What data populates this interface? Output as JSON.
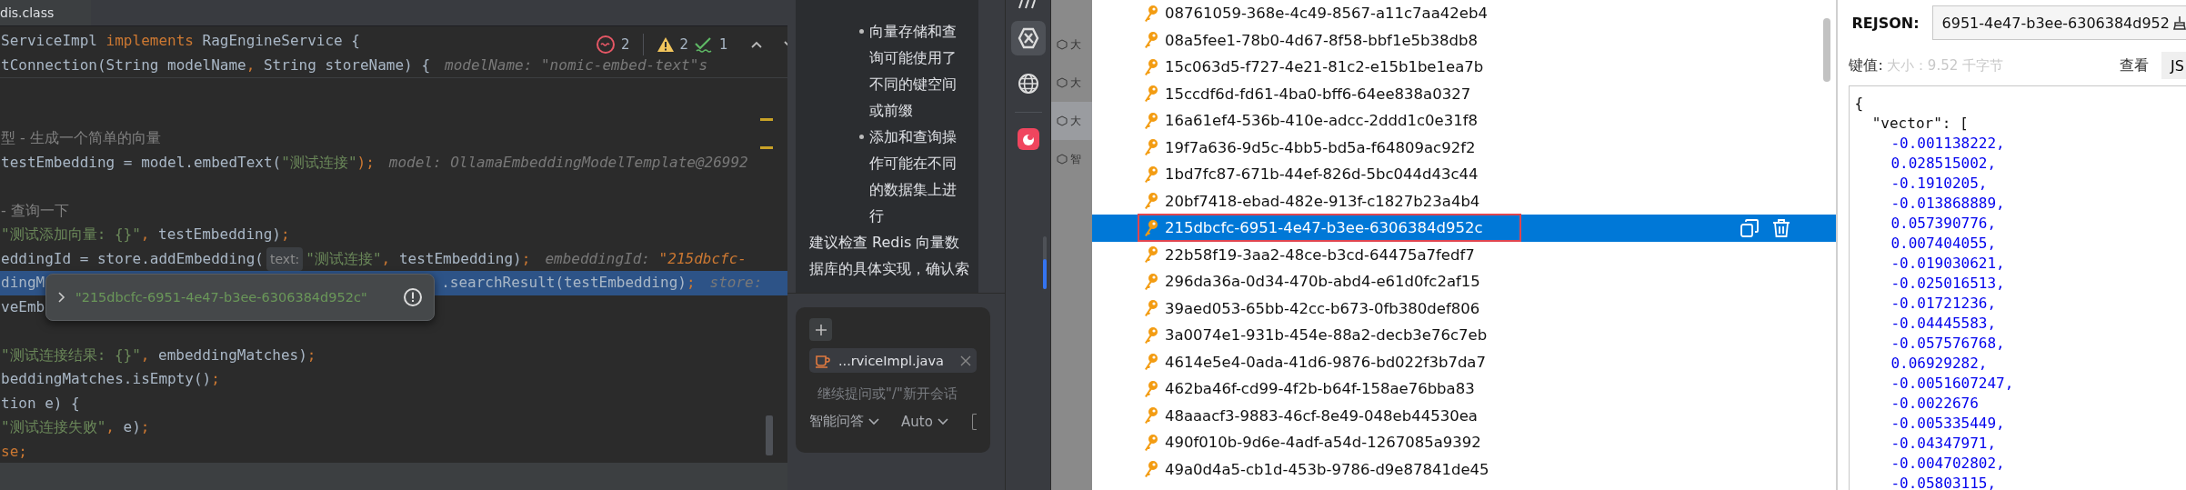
{
  "editor": {
    "tab": "dis.class",
    "inspections": {
      "errors": "2",
      "warnings": "2",
      "checks": "1"
    },
    "lines": [
      {
        "highlighted": false,
        "segments": [
          {
            "t": "ServiceImpl ",
            "kind": "plain"
          },
          {
            "t": "implements ",
            "kind": "keyword"
          },
          {
            "t": "RagEngineService {",
            "kind": "plain"
          }
        ]
      },
      {
        "highlighted": false,
        "segments": [
          {
            "t": "tConnection(String modelName",
            "kind": "plain"
          },
          {
            "t": ", ",
            "kind": "punct"
          },
          {
            "t": "String storeName) {",
            "kind": "plain"
          },
          {
            "t": "modelName: \"nomic-embed-text\"",
            "kind": "hint"
          },
          {
            "t": "s",
            "kind": "hint"
          }
        ]
      },
      {
        "highlighted": false
      },
      {
        "highlighted": false
      },
      {
        "highlighted": false,
        "segments": [
          {
            "t": "型 - 生成一个简单的向量",
            "kind": "comment"
          }
        ]
      },
      {
        "highlighted": false,
        "segments": [
          {
            "t": "testEmbedding = model.embedText(",
            "kind": "plain"
          },
          {
            "t": "\"测试连接\"",
            "kind": "string"
          },
          {
            "t": ");",
            "kind": "punct"
          },
          {
            "t": "model: OllamaEmbeddingModelTemplate@26992",
            "kind": "hint"
          }
        ]
      },
      {
        "highlighted": false
      },
      {
        "highlighted": false,
        "segments": [
          {
            "t": "- 查询一下",
            "kind": "comment"
          }
        ]
      },
      {
        "highlighted": false,
        "segments": [
          {
            "t": "\"测试添加向量: {}\"",
            "kind": "string"
          },
          {
            "t": ", ",
            "kind": "punct"
          },
          {
            "t": "testEmbedding)",
            "kind": "plain"
          },
          {
            "t": ";",
            "kind": "punct"
          }
        ]
      },
      {
        "highlighted": false,
        "segments": [
          {
            "t": "eddingId = store.addEmbedding(",
            "kind": "plain"
          },
          {
            "t": "text:",
            "kind": "inlay"
          },
          {
            "t": "\"测试连接\"",
            "kind": "string"
          },
          {
            "t": ", ",
            "kind": "punct"
          },
          {
            "t": "testEmbedding)",
            "kind": "plain"
          },
          {
            "t": ";",
            "kind": "punct"
          },
          {
            "t": "embeddingId: ",
            "kind": "hint"
          },
          {
            "t": "\"215dbcfc-",
            "kind": "hint_value"
          }
        ]
      },
      {
        "highlighted": true,
        "segments": [
          {
            "t": "dingM",
            "kind": "plain"
          },
          {
            "t": ".searchResult(testEmbedding)",
            "kind": "plain",
            "after_popup": true
          },
          {
            "t": ";",
            "kind": "punct"
          },
          {
            "t": "store:",
            "kind": "hint"
          }
        ]
      },
      {
        "highlighted": false,
        "segments": [
          {
            "t": "veEmb",
            "kind": "plain"
          }
        ]
      },
      {
        "highlighted": false
      },
      {
        "highlighted": false,
        "segments": [
          {
            "t": "\"测试连接结果: {}\"",
            "kind": "string"
          },
          {
            "t": ", ",
            "kind": "punct"
          },
          {
            "t": "embeddingMatches)",
            "kind": "plain"
          },
          {
            "t": ";",
            "kind": "punct"
          }
        ]
      },
      {
        "highlighted": false,
        "segments": [
          {
            "t": "beddingMatches.isEmpty()",
            "kind": "plain"
          },
          {
            "t": ";",
            "kind": "punct"
          }
        ]
      },
      {
        "highlighted": false,
        "segments": [
          {
            "t": "tion e) {",
            "kind": "plain"
          }
        ]
      },
      {
        "highlighted": false,
        "segments": [
          {
            "t": "\"测试连接失败\"",
            "kind": "string"
          },
          {
            "t": ", ",
            "kind": "punct"
          },
          {
            "t": "e)",
            "kind": "plain"
          },
          {
            "t": ";",
            "kind": "punct"
          }
        ]
      },
      {
        "highlighted": false,
        "segments": [
          {
            "t": "se;",
            "kind": "keyword"
          }
        ]
      }
    ],
    "popup": {
      "value": "\"215dbcfc-6951-4e47-b3ee-6306384d952c\""
    }
  },
  "chat": {
    "bullets": [
      "向量存储和查询可能使用了不同的键空间或前缀",
      "添加和查询操作可能在不同的数据集上进行"
    ],
    "paragraph": "建议检查 Redis 向量数据库的具体实现，确认索",
    "attachment": "...rviceImpl.java",
    "placeholder": "继续提问或\"/\"新开会话",
    "mode": "智能问答",
    "model": "Auto"
  },
  "sidebar": {
    "items": [
      "大",
      "大",
      "大",
      "智"
    ]
  },
  "keys": [
    {
      "name": "08761059-368e-4c49-8567-a11c7aa42eb4",
      "selected": false
    },
    {
      "name": "08a5fee1-78b0-4d67-8f58-bbf1e5b38db8",
      "selected": false
    },
    {
      "name": "15c063d5-f727-4e21-81c2-e15b1be1ea7b",
      "selected": false
    },
    {
      "name": "15ccdf6d-fd61-4ba0-bff6-64ee838a0327",
      "selected": false
    },
    {
      "name": "16a61ef4-536b-410e-adcc-2ddd1c0e31f8",
      "selected": false
    },
    {
      "name": "19f7a636-9d5c-4bb5-bd5a-f64809ac92f2",
      "selected": false
    },
    {
      "name": "1bd7fc87-671b-44ef-826d-5bc044d43c44",
      "selected": false
    },
    {
      "name": "20bf7418-ebad-482e-913f-c1827b23a4b4",
      "selected": false
    },
    {
      "name": "215dbcfc-6951-4e47-b3ee-6306384d952c",
      "selected": true
    },
    {
      "name": "22b58f19-3aa2-48ce-b3cd-64475a7fedf7",
      "selected": false
    },
    {
      "name": "296da36a-0d34-470b-abd4-e61d0fc2af15",
      "selected": false
    },
    {
      "name": "39aed053-65bb-42cc-b673-0fb380def806",
      "selected": false
    },
    {
      "name": "3a0074e1-931b-454e-88a2-decb3e76c7eb",
      "selected": false
    },
    {
      "name": "4614e5e4-0ada-41d6-9876-bd022f3b7da7",
      "selected": false
    },
    {
      "name": "462ba46f-cd99-4f2b-b64f-158ae76bba83",
      "selected": false
    },
    {
      "name": "48aaacf3-9883-46cf-8e49-048eb44530ea",
      "selected": false
    },
    {
      "name": "490f010b-9d6e-4adf-a54d-1267085a9392",
      "selected": false
    },
    {
      "name": "49a0d4a5-cb1d-453b-9786-d9e87841de45",
      "selected": false
    }
  ],
  "detail": {
    "type_label": "REJSON:",
    "key_value": "6951-4e47-b3ee-6306384d952",
    "value_label": "键值:",
    "size": "大小：9.52 千字节",
    "view_label": "查看",
    "view_button": "JS",
    "json_lines": [
      {
        "text": "{",
        "kind": "punct"
      },
      {
        "text": "  \"vector\": [",
        "kind": "punct"
      },
      {
        "text": "-0.001138222,",
        "kind": "number"
      },
      {
        "text": "0.028515002,",
        "kind": "number"
      },
      {
        "text": "-0.1910205,",
        "kind": "number"
      },
      {
        "text": "-0.013868889,",
        "kind": "number"
      },
      {
        "text": "0.057390776,",
        "kind": "number"
      },
      {
        "text": "0.007404055,",
        "kind": "number"
      },
      {
        "text": "-0.019030621,",
        "kind": "number"
      },
      {
        "text": "-0.025016513,",
        "kind": "number"
      },
      {
        "text": "-0.01721236,",
        "kind": "number"
      },
      {
        "text": "-0.04445583,",
        "kind": "number"
      },
      {
        "text": "-0.057576768,",
        "kind": "number"
      },
      {
        "text": "0.06929282,",
        "kind": "number"
      },
      {
        "text": "-0.0051607247,",
        "kind": "number"
      },
      {
        "text": "-0.0022676",
        "kind": "number"
      },
      {
        "text": "-0.005335449,",
        "kind": "number"
      },
      {
        "text": "-0.04347971,",
        "kind": "number"
      },
      {
        "text": "-0.004702802,",
        "kind": "number"
      },
      {
        "text": "-0.05803115,",
        "kind": "number"
      }
    ]
  }
}
